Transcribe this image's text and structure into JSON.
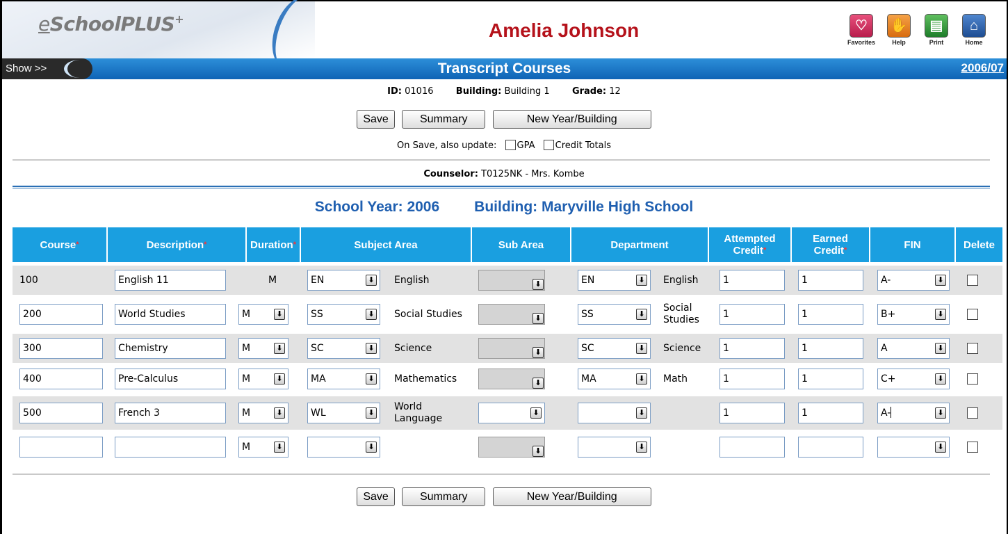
{
  "header": {
    "logo_e": "e",
    "logo_rest": "SchoolPLUS",
    "logo_plus": "+",
    "student_name": "Amelia Johnson",
    "toolbar": [
      {
        "label": "Favorites",
        "icon": "heart-icon"
      },
      {
        "label": "Help",
        "icon": "hand-icon"
      },
      {
        "label": "Print",
        "icon": "printer-icon"
      },
      {
        "label": "Home",
        "icon": "house-icon"
      }
    ]
  },
  "titlebar": {
    "show_label": "Show >>",
    "page_title": "Transcript Courses",
    "school_year": "2006/07"
  },
  "student": {
    "id_label": "ID:",
    "id_value": "01016",
    "building_label": "Building:",
    "building_value": "Building 1",
    "grade_label": "Grade:",
    "grade_value": "12"
  },
  "buttons": {
    "save": "Save",
    "summary": "Summary",
    "new_year_building": "New Year/Building"
  },
  "update": {
    "label": "On Save, also update:",
    "gpa": "GPA",
    "credit_totals": "Credit Totals"
  },
  "counselor": {
    "label": "Counselor:",
    "value": "T0125NK - Mrs. Kombe"
  },
  "section": {
    "school_year": "School Year: 2006",
    "building": "Building: Maryville High School"
  },
  "columns": {
    "course": "Course",
    "description": "Description",
    "duration": "Duration",
    "subject_area": "Subject Area",
    "sub_area": "Sub Area",
    "department": "Department",
    "attempted_1": "Attempted",
    "attempted_2": "Credit",
    "earned_1": "Earned",
    "earned_2": "Credit",
    "fin": "FIN",
    "delete": "Delete",
    "required_mark": "*"
  },
  "rows": [
    {
      "course": "100",
      "description": "English 11",
      "duration": "M",
      "subject_code": "EN",
      "subject_name": "English",
      "department_code": "EN",
      "department_name": "English",
      "attempted": "1",
      "earned": "1",
      "fin": "A-"
    },
    {
      "course": "200",
      "description": "World Studies",
      "duration": "M",
      "subject_code": "SS",
      "subject_name": "Social Studies",
      "department_code": "SS",
      "department_name": "Social Studies",
      "attempted": "1",
      "earned": "1",
      "fin": "B+"
    },
    {
      "course": "300",
      "description": "Chemistry",
      "duration": "M",
      "subject_code": "SC",
      "subject_name": "Science",
      "department_code": "SC",
      "department_name": "Science",
      "attempted": "1",
      "earned": "1",
      "fin": "A"
    },
    {
      "course": "400",
      "description": "Pre-Calculus",
      "duration": "M",
      "subject_code": "MA",
      "subject_name": "Mathematics",
      "department_code": "MA",
      "department_name": "Math",
      "attempted": "1",
      "earned": "1",
      "fin": "C+"
    },
    {
      "course": "500",
      "description": "French 3",
      "duration": "M",
      "subject_code": "WL",
      "subject_name": "World Language",
      "department_code": "",
      "department_name": "",
      "attempted": "1",
      "earned": "1",
      "fin": "A-"
    },
    {
      "course": "",
      "description": "",
      "duration": "M",
      "subject_code": "",
      "subject_name": "",
      "department_code": "",
      "department_name": "",
      "attempted": "",
      "earned": "",
      "fin": ""
    }
  ],
  "colors": {
    "brand_red": "#b5121b",
    "title_blue": "#1f5fb0",
    "header_cell": "#1a9fe0"
  }
}
